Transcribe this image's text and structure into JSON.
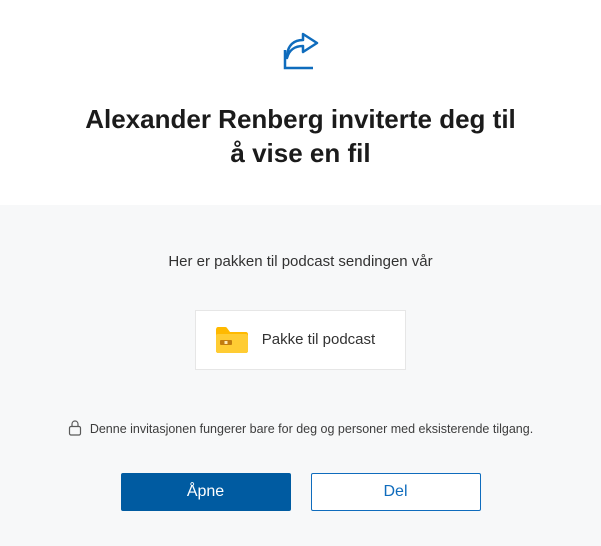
{
  "header": {
    "title": "Alexander Renberg inviterte deg til å vise en fil"
  },
  "message": "Her er pakken til podcast sendingen vår",
  "file": {
    "name": "Pakke til podcast",
    "icon": "zip-folder"
  },
  "permission_note": "Denne invitasjonen fungerer bare for deg og personer med eksisterende tilgang.",
  "buttons": {
    "open": "Åpne",
    "share": "Del"
  },
  "colors": {
    "accent": "#0f6cbd",
    "primary_button": "#005ba1"
  }
}
